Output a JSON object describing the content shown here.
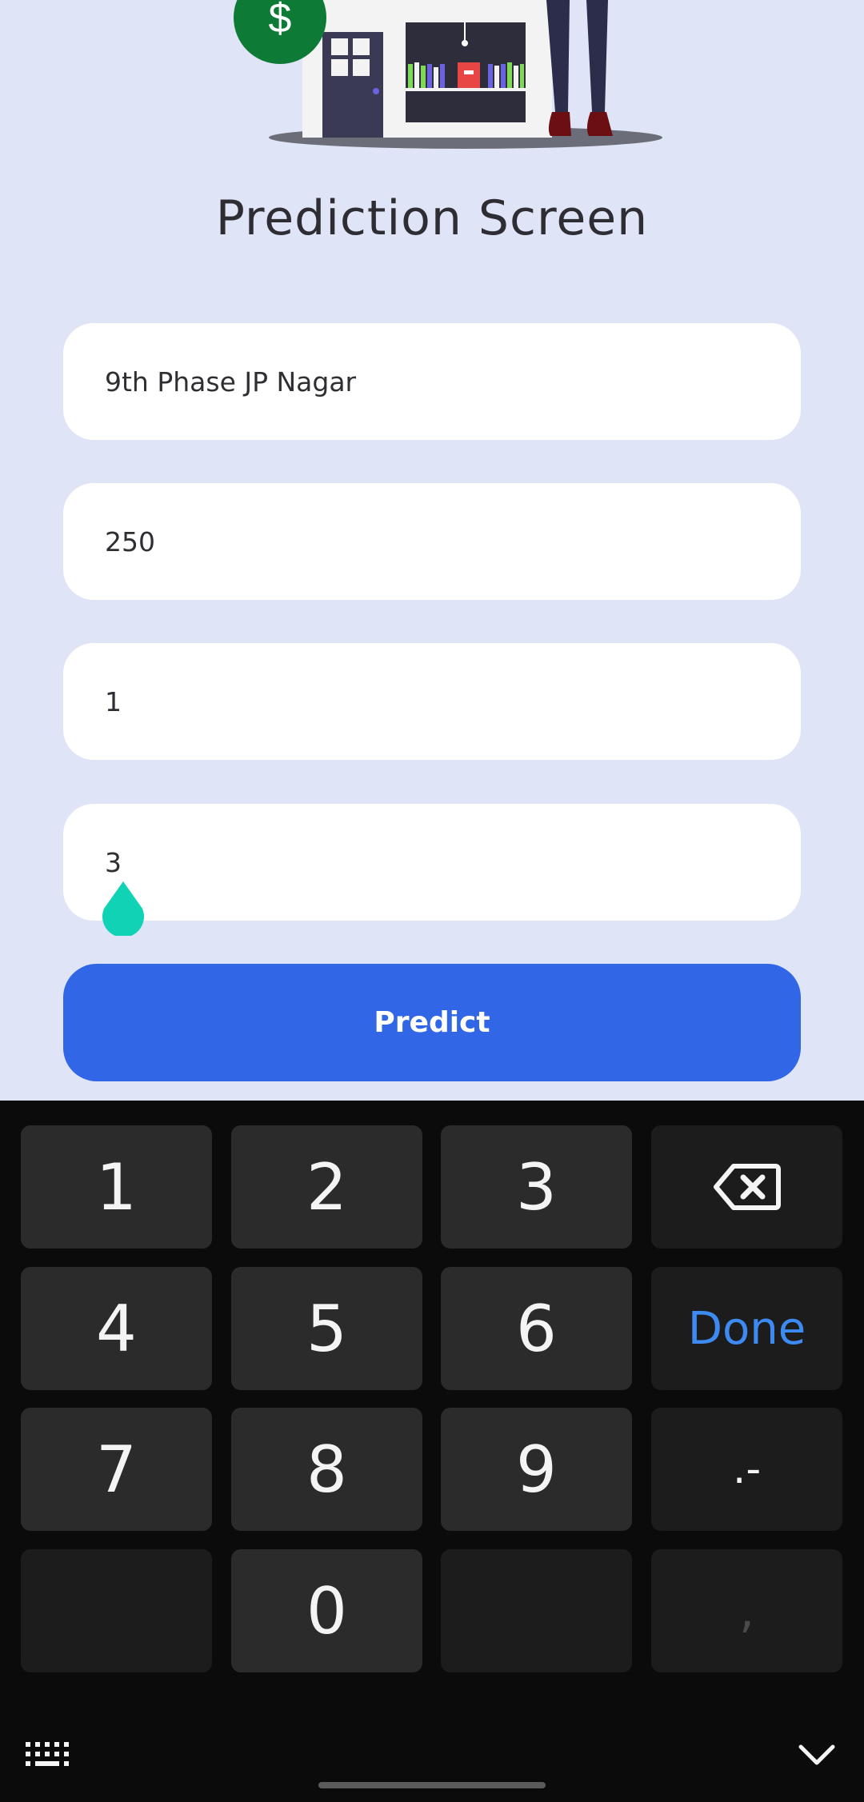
{
  "screen": {
    "title": "Prediction Screen"
  },
  "illustration": {
    "dollar_symbol": "$"
  },
  "form": {
    "fields": [
      {
        "value": "9th Phase JP Nagar"
      },
      {
        "value": "250"
      },
      {
        "value": "1"
      },
      {
        "value": "3"
      }
    ],
    "predict_label": "Predict"
  },
  "keyboard": {
    "keys": {
      "k1": "1",
      "k2": "2",
      "k3": "3",
      "k4": "4",
      "k5": "5",
      "k6": "6",
      "k7": "7",
      "k8": "8",
      "k9": "9",
      "k0": "0",
      "done": "Done",
      "punct": ".-",
      "comma": ","
    },
    "icons": {
      "backspace": "backspace-icon",
      "layout": "keyboard-layout-icon",
      "hide": "chevron-down-icon"
    }
  },
  "colors": {
    "background": "#dfe5f6",
    "accent": "#3166e6",
    "handle": "#10d3b6",
    "done": "#3d8bf2"
  }
}
